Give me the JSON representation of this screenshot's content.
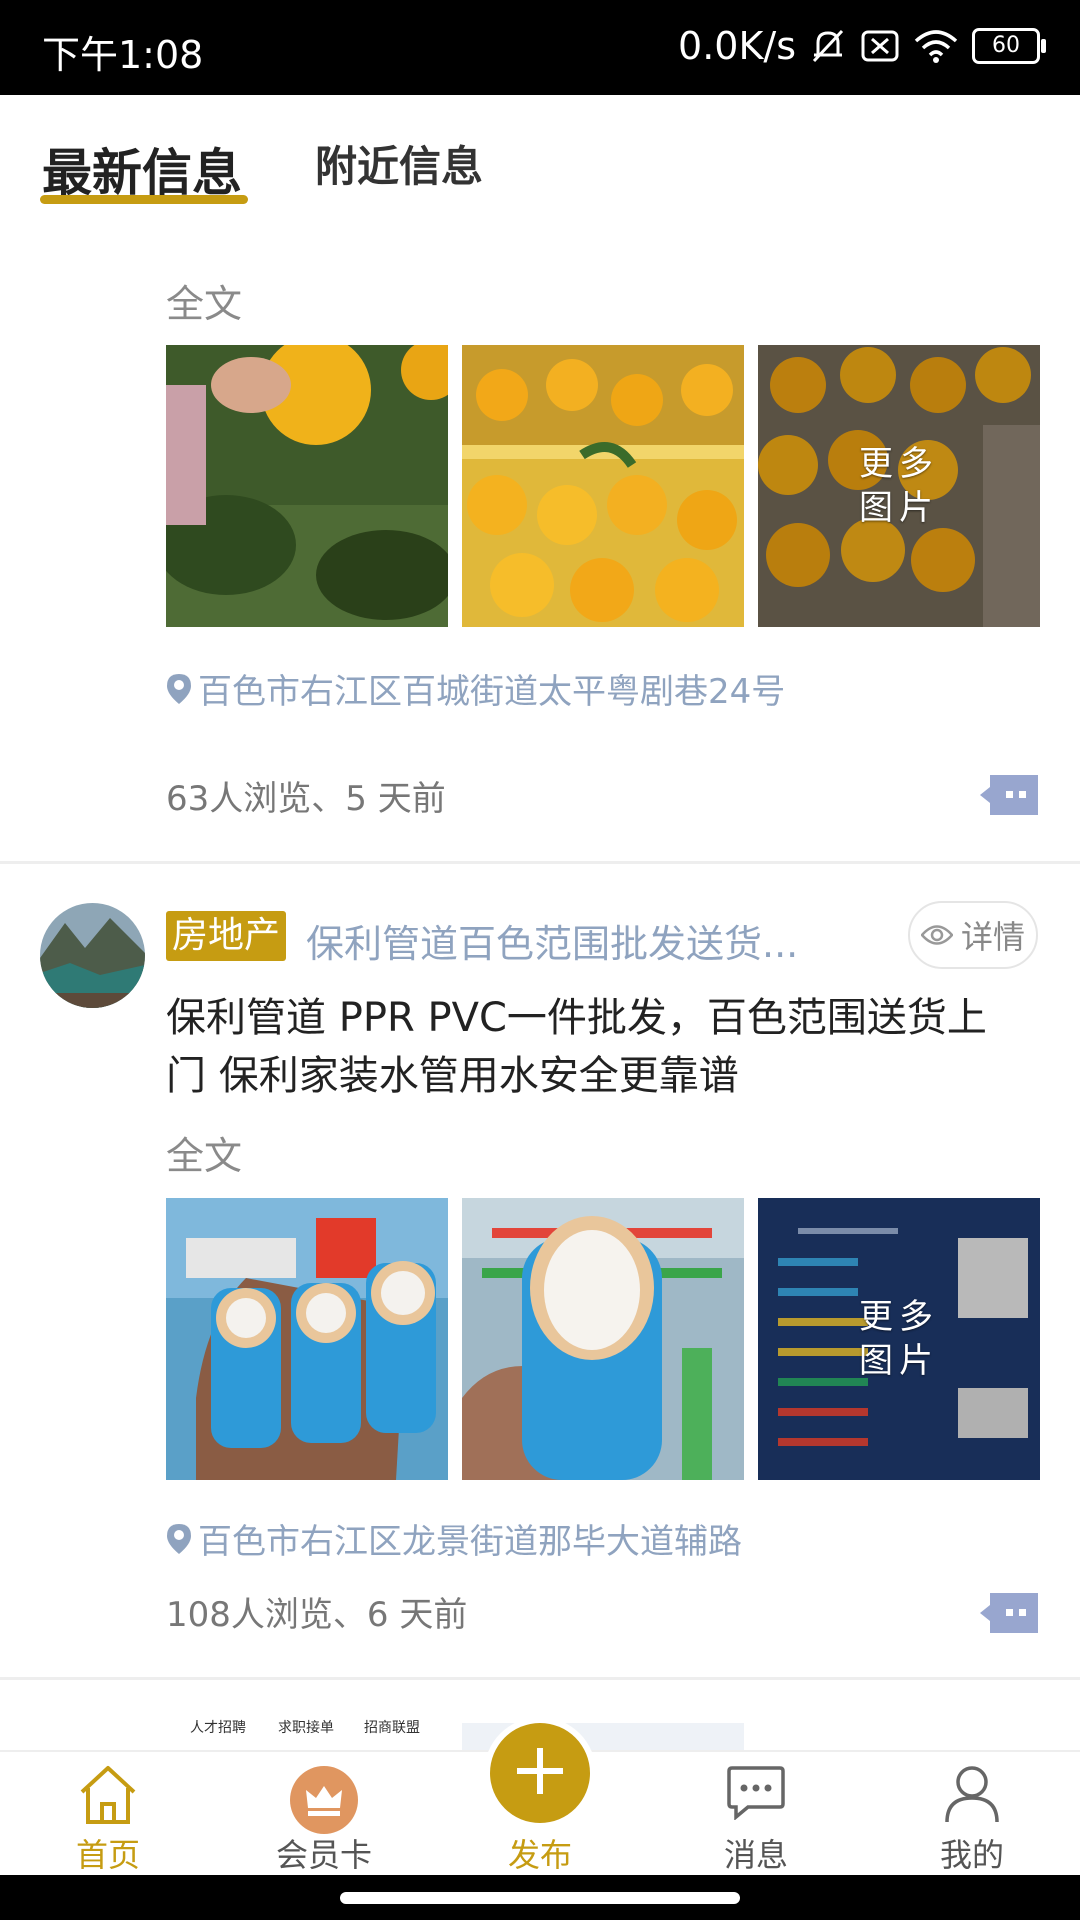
{
  "status_bar": {
    "time": "下午1:08",
    "network_speed": "0.0K/s",
    "battery": "60",
    "icons": [
      "mute-bell-icon",
      "sim-off-icon",
      "wifi-icon",
      "battery-icon"
    ]
  },
  "tabs": [
    {
      "label": "最新信息",
      "active": true
    },
    {
      "label": "附近信息",
      "active": false
    }
  ],
  "posts": [
    {
      "full_text_link": "全文",
      "images": [
        "orange-tree-photo",
        "orange-crate-photo",
        "orange-pile-photo"
      ],
      "more_images_label": "更多\n图片",
      "location": "百色市右江区百城街道太平粤剧巷24号",
      "stats": "63人浏览、5 天前"
    },
    {
      "category": "房地产",
      "title": "保利管道百色范围批发送货...",
      "detail_label": "详情",
      "body": "保利管道 PPR PVC一件批发，百色范围送货上门 保利家装水管用水安全更靠谱",
      "full_text_link": "全文",
      "images": [
        "pipes-in-hand-photo",
        "pipe-closeup-photo",
        "pipe-catalog-board-photo"
      ],
      "more_images_label": "更多\n图片",
      "location": "百色市右江区龙景街道那毕大道辅路",
      "stats": "108人浏览、6 天前"
    },
    {
      "partial_banner_labels": [
        "人才招聘",
        "求职接单",
        "招商联盟"
      ]
    }
  ],
  "bottom_nav": [
    {
      "label": "首页",
      "icon": "home-icon",
      "active": true
    },
    {
      "label": "会员卡",
      "icon": "crown-icon",
      "active": false
    },
    {
      "label": "发布",
      "icon": "plus-icon",
      "active": true
    },
    {
      "label": "消息",
      "icon": "message-icon",
      "active": false
    },
    {
      "label": "我的",
      "icon": "user-icon",
      "active": false
    }
  ],
  "colors": {
    "accent": "#c69c12",
    "link_blue_gray": "#8fa3bf",
    "comment_icon": "#98a6cf"
  }
}
